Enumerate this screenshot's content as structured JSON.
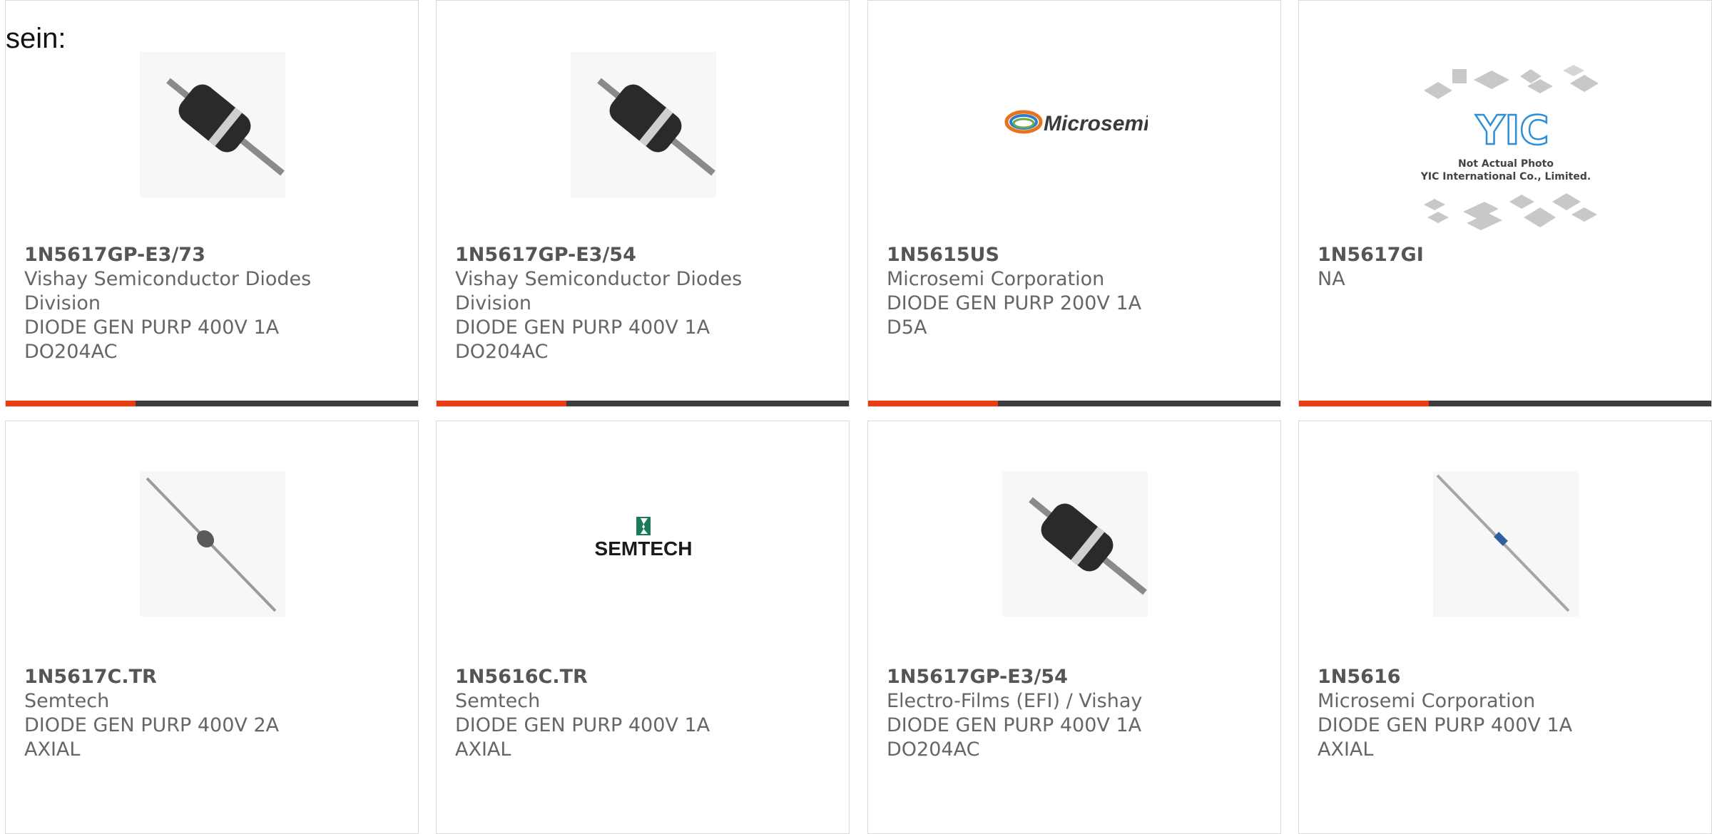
{
  "intro_text": "sein:",
  "accent_color": "#e63d12",
  "bar_color": "#3d3d3d",
  "products": [
    {
      "part": "1N5617GP-E3/73",
      "manufacturer": "Vishay Semiconductor Diodes Division",
      "description": "DIODE GEN PURP 400V 1A DO204AC",
      "image": "axial-diode-black-photo"
    },
    {
      "part": "1N5617GP-E3/54",
      "manufacturer": "Vishay Semiconductor Diodes Division",
      "description": "DIODE GEN PURP 400V 1A DO204AC",
      "image": "axial-diode-black-photo"
    },
    {
      "part": "1N5615US",
      "manufacturer": "Microsemi Corporation",
      "description": "DIODE GEN PURP 200V 1A D5A",
      "image": "microsemi-logo",
      "logo_text": "Microsemi"
    },
    {
      "part": "1N5617GI",
      "manufacturer": "NA",
      "description": "",
      "image": "yic-placeholder",
      "logo_text": "YIC",
      "caption_line1": "Not Actual Photo",
      "caption_line2": "YIC International Co., Limited."
    },
    {
      "part": "1N5617C.TR",
      "manufacturer": "Semtech",
      "description": "DIODE GEN PURP 400V 2A AXIAL",
      "image": "axial-diode-small-photo"
    },
    {
      "part": "1N5616C.TR",
      "manufacturer": "Semtech",
      "description": "DIODE GEN PURP 400V 1A AXIAL",
      "image": "semtech-logo",
      "logo_text": "SEMTECH"
    },
    {
      "part": "1N5617GP-E3/54",
      "manufacturer": "Electro-Films (EFI) / Vishay",
      "description": "DIODE GEN PURP 400V 1A DO204AC",
      "image": "axial-diode-black-photo"
    },
    {
      "part": "1N5616",
      "manufacturer": "Microsemi Corporation",
      "description": "DIODE GEN PURP 400V 1A AXIAL",
      "image": "axial-diode-blue-photo"
    }
  ]
}
